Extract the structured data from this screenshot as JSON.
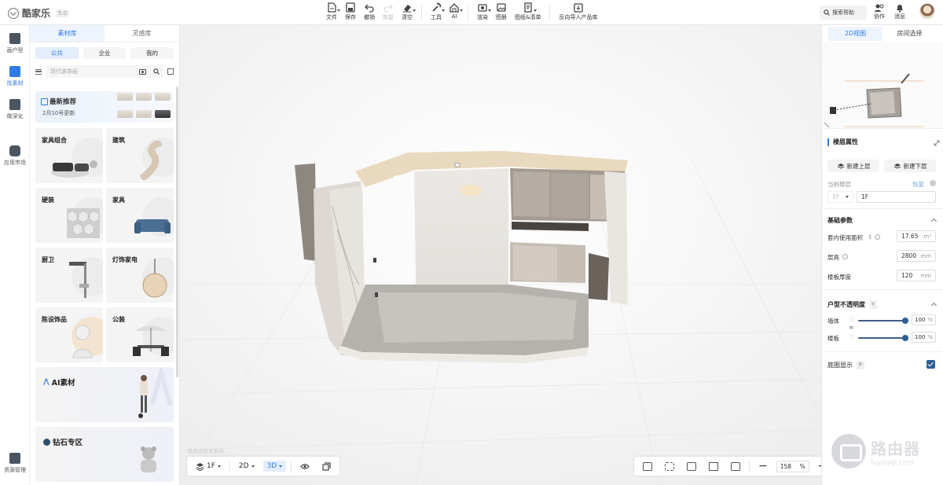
{
  "app": {
    "name": "酷家乐",
    "version": "5.0"
  },
  "toolbar": {
    "items": [
      {
        "label": "文件",
        "icon": "file-icon",
        "caret": true
      },
      {
        "label": "保存",
        "icon": "save-icon"
      },
      {
        "label": "撤销",
        "icon": "undo-icon"
      },
      {
        "label": "恢复",
        "icon": "redo-icon",
        "disabled": true
      },
      {
        "label": "清空",
        "icon": "eraser-icon",
        "caret": true
      },
      {
        "label": "工具",
        "icon": "wrench-icon",
        "caret": true
      },
      {
        "label": "AI",
        "icon": "ai-house-icon",
        "caret": true
      },
      {
        "label": "渲染",
        "icon": "camera-icon",
        "caret": true
      },
      {
        "label": "图册",
        "icon": "album-icon"
      },
      {
        "label": "图纸&清单",
        "icon": "drawing-list-icon",
        "caret": true
      },
      {
        "label": "反向导入产品库",
        "icon": "reverse-import-icon"
      }
    ]
  },
  "header_right": {
    "search_help": "搜索帮助",
    "collab": "协作",
    "messages": "消息"
  },
  "rail": {
    "items": [
      {
        "label": "画户型",
        "icon": "floorplan-icon"
      },
      {
        "label": "找素材",
        "icon": "sofa-icon",
        "active": true
      },
      {
        "label": "做深化",
        "icon": "deepen-icon"
      },
      {
        "label": "应用市场",
        "icon": "puzzle-icon"
      }
    ],
    "bottom": "资源管理"
  },
  "panel": {
    "tabs": [
      "素材库",
      "灵感库"
    ],
    "scopes": [
      "公共",
      "企业",
      "我的"
    ],
    "search_placeholder": "现代装饰画",
    "featured": {
      "title": "最新推荐",
      "subtitle": "2月10号更新"
    },
    "categories": [
      "家具组合",
      "建筑",
      "硬装",
      "家具",
      "厨卫",
      "灯饰家电",
      "陈设饰品",
      "公装"
    ],
    "big_cards": [
      "AI素材",
      "钻石专区"
    ]
  },
  "viewport": {
    "watermark": "酷家乐技术支持",
    "floor": "1F",
    "view_2d": "2D",
    "view_3d": "3D",
    "zoom": "158",
    "zoom_unit": "%"
  },
  "right_panel": {
    "tabs": [
      "2D视图",
      "房间选择"
    ],
    "floor_props": {
      "title": "楼层属性",
      "new_upper": "新建上层",
      "new_lower": "新建下层",
      "current_floor_label": "当前楼层",
      "reset": "恢复",
      "floor_left": "1F",
      "floor_value": "1F"
    },
    "basic": {
      "title": "基础参数",
      "area_label": "套内使用面积",
      "area_value": "17.65",
      "area_unit": "m²",
      "height_label": "层高",
      "height_value": "2800",
      "height_unit": "mm",
      "thickness_label": "楼板厚度",
      "thickness_value": "120",
      "thickness_unit": "mm"
    },
    "opacity": {
      "title": "户型不透明度",
      "key": "Y",
      "wall_label": "墙体",
      "wall_value": "100",
      "slab_label": "楼板",
      "slab_value": "100",
      "unit": "%",
      "wall_level": 1.0,
      "slab_level": 1.0
    },
    "base_display": {
      "label": "底图显示",
      "key": "P",
      "checked": true
    }
  },
  "corner_watermark": {
    "title": "路由器",
    "subtitle": "luyouqi.com"
  },
  "colors": {
    "accent": "#2d7be5",
    "slider": "#2f5f94"
  }
}
